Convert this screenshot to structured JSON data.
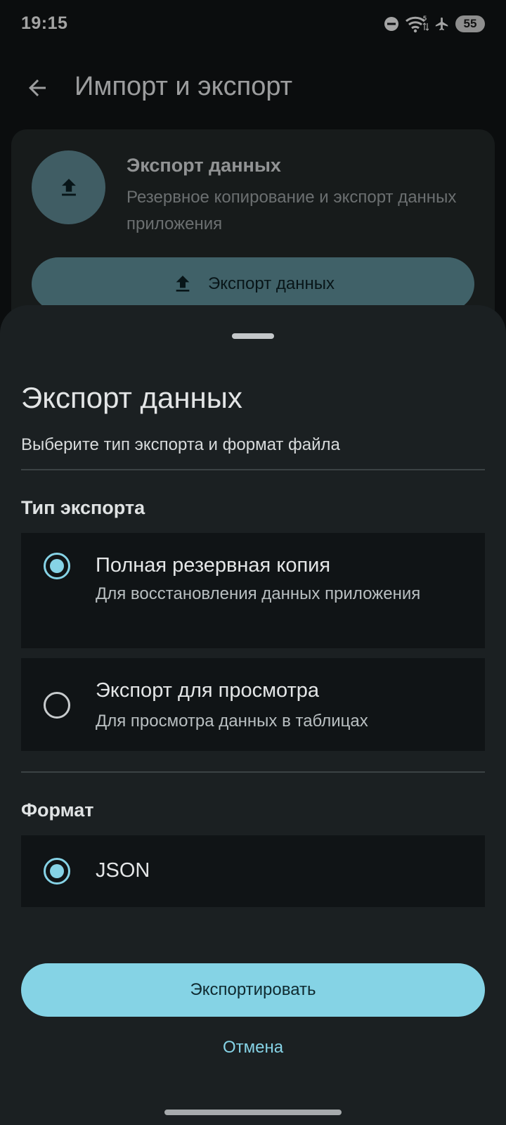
{
  "status_bar": {
    "time": "19:15",
    "icons": [
      "do-not-disturb-icon",
      "wifi-icon",
      "airplane-icon"
    ],
    "wifi_badge": "5",
    "battery": "55"
  },
  "app_bar": {
    "back_icon": "arrow-left-icon",
    "title": "Импорт и экспорт"
  },
  "export_card": {
    "icon": "upload-icon",
    "title": "Экспорт данных",
    "subtitle": "Резервное копирование и экспорт данных приложения",
    "button_label": "Экспорт данных"
  },
  "sheet": {
    "title": "Экспорт данных",
    "subtitle": "Выберите тип экспорта и формат файла",
    "export_type": {
      "label": "Тип экспорта",
      "options": [
        {
          "title": "Полная резервная копия",
          "description": "Для восстановления данных приложения",
          "selected": true
        },
        {
          "title": "Экспорт для просмотра",
          "description": "Для просмотра данных в таблицах",
          "selected": false
        }
      ]
    },
    "format": {
      "label": "Формат",
      "options": [
        {
          "title": "JSON",
          "selected": true
        }
      ]
    },
    "confirm_label": "Экспортировать",
    "cancel_label": "Отмена"
  },
  "colors": {
    "accent": "#86d3e6",
    "sheet_bg": "#1b2022",
    "option_bg": "#101416"
  }
}
